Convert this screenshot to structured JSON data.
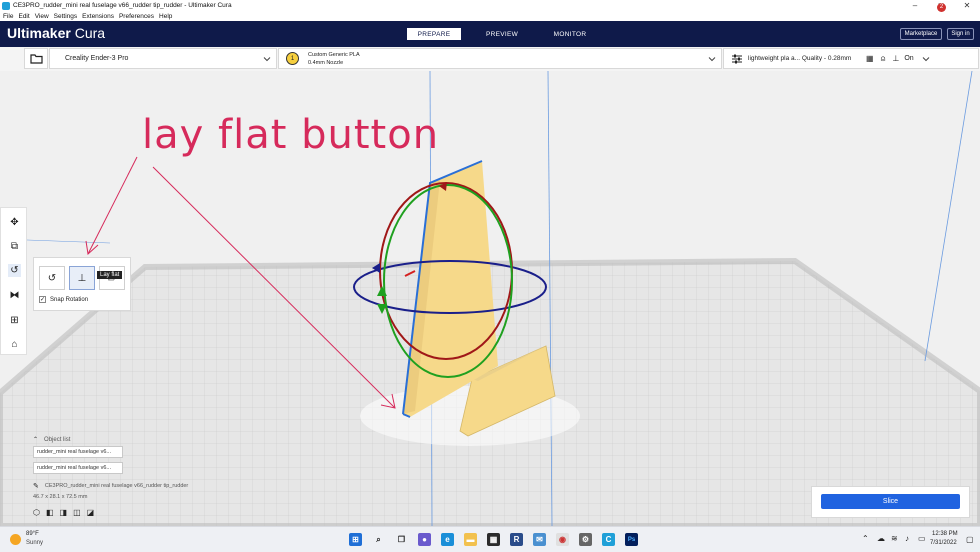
{
  "window": {
    "title": "CE3PRO_rudder_mini real fuselage v66_rudder tip_rudder - Ultimaker Cura",
    "minimize": "–",
    "maximize": "□",
    "close": "✕"
  },
  "menu": [
    "File",
    "Edit",
    "View",
    "Settings",
    "Extensions",
    "Preferences",
    "Help"
  ],
  "header": {
    "brand_bold": "Ultimaker",
    "brand_light": "Cura",
    "stages": [
      "PREPARE",
      "PREVIEW",
      "MONITOR"
    ],
    "marketplace": "Marketplace",
    "marketplace_badge": "2",
    "signin": "Sign in"
  },
  "config": {
    "printer": "Creality Ender-3 Pro",
    "material": "Custom Generic PLA",
    "nozzle": "0.4mm Nozzle",
    "extruder_number": "1",
    "profile": "lightweight pla a... Quality - 0.28mm",
    "support": "On"
  },
  "rotate_panel": {
    "snap_label": "Snap Rotation",
    "tooltip": "Lay flat"
  },
  "object_list": {
    "label": "Object list",
    "items": [
      "rudder_mini real fuselage v6...",
      "rudder_mini real fuselage v6..."
    ],
    "current_file": "CE3PRO_rudder_mini real fuselage v66_rudder tip_rudder",
    "dimensions": "46.7 x 28.1 x 72.5 mm"
  },
  "slice": {
    "button": "Slice"
  },
  "annotation": {
    "text": "lay flat button"
  },
  "taskbar": {
    "temperature": "89°F",
    "condition": "Sunny",
    "time": "12:38 PM",
    "date": "7/31/2022"
  },
  "colors": {
    "header": "#0f1a4a",
    "model": "#f6d98a",
    "annotation": "#d62a5b",
    "slice_button": "#2063e0"
  }
}
